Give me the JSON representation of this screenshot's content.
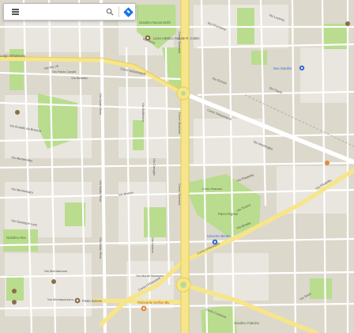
{
  "search": {
    "placeholder": "",
    "value": ""
  },
  "controls": {
    "menu_icon": "hamburger-menu-icon",
    "search_icon": "magnifier-icon",
    "directions_icon": "directions-diamond-icon"
  },
  "colors": {
    "land": "#dcd8cc",
    "block": "#e9e6df",
    "park": "#b9dc8f",
    "main_road": "#f7e58a",
    "street": "#ffffff",
    "label": "#555555",
    "poi_brown": "#8a6e4b",
    "poi_blue": "#3b6fd4",
    "poi_orange": "#e0883a"
  },
  "map": {
    "street_labels": [
      "Corso Sebastopoli",
      "Corso Siracusa",
      "Corso Siracusa",
      "Corso Siracusa",
      "Via Guido Reni",
      "Via Guido Reni",
      "Via Guido Reni",
      "Corso Orbassano",
      "Corso Orbassano",
      "Corso Sebastopoli",
      "Via Monte Novegno",
      "Via Tirreno",
      "Corso Cosenza",
      "Via Filadelfia",
      "Via Baltimora",
      "Via Filadelfia",
      "Via Ventimiglia",
      "Via Chambery",
      "Via Lucento",
      "Via Pio VII",
      "Via Nizza",
      "Via Arnaldo da Brescia",
      "Via Montevideo",
      "Via Montenegro",
      "Via Giuseppe Luini",
      "Via Fabio Cavalli",
      "Via Barletta",
      "Via Gorizia",
      "Via Tripoli",
      "Via Bisalta",
      "Via Boston",
      "Via Caraglio",
      "Via Livorno",
      "Via Mombarcaro",
      "Via Montepulciano",
      "Via Sarpi"
    ],
    "place_labels": [
      "Giardino Nuova Delhi",
      "Liceo Artistico Statale R. Cottini",
      "Parco Rignon",
      "Universo Bimbo",
      "Giardino Alex",
      "Poste Italiane",
      "Ristorante Delfino Blu",
      "Giardino Fabrizio",
      "Due Giardini",
      "Corso Siracusa",
      "Largo Orbassano"
    ],
    "points": [
      "Liceo Artistico Statale R. Cottini",
      "Universo Bimbo",
      "Poste Italiane",
      "Ristorante Delfino Blu",
      "Due Giardini"
    ]
  }
}
